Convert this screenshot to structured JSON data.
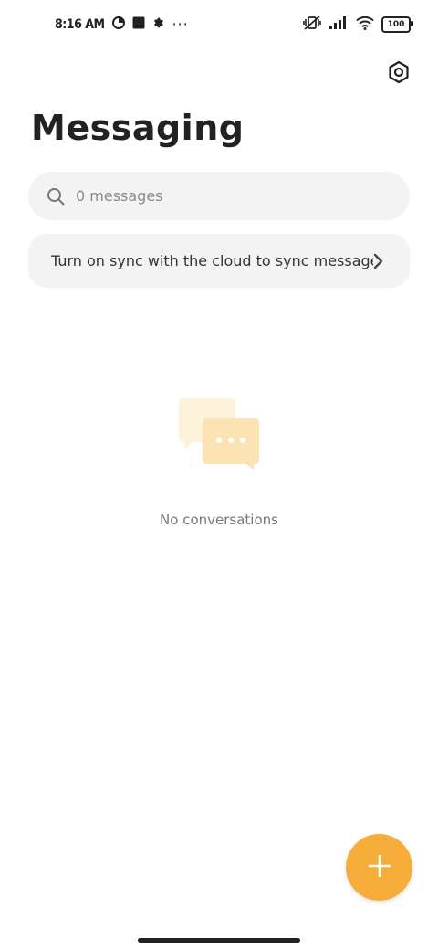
{
  "status_bar": {
    "time": "8:16 AM",
    "battery": "100",
    "more_glyph": "···"
  },
  "header": {
    "title": "Messaging"
  },
  "search": {
    "placeholder": "0 messages"
  },
  "sync_banner": {
    "text": "Turn on sync with the cloud to sync messages"
  },
  "empty_state": {
    "text": "No conversations"
  },
  "colors": {
    "accent": "#f6ad3a",
    "card_bg": "#f3f3f3",
    "illustration_back": "#fdf3dc",
    "illustration_front": "#fbe3b3"
  },
  "icons": [
    "settings-icon",
    "search-icon",
    "chevron-right-icon",
    "add-icon",
    "chat-bubbles-icon"
  ]
}
